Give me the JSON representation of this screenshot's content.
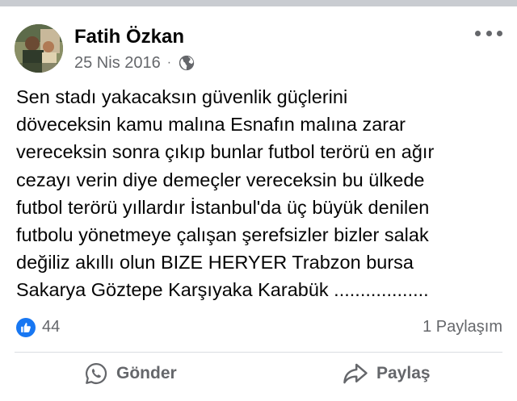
{
  "post": {
    "author": "Fatih Özkan",
    "date": "25 Nis 2016",
    "separator": "·",
    "privacy_icon": "globe-icon",
    "text_lines": [
      "Sen stadı yakacaksın güvenlik güçlerini",
      "döveceksin kamu malına Esnafın malına zarar",
      "vereceksin sonra çıkıp bunlar futbol terörü en ağır",
      "cezayı verin diye demeçler vereceksin bu ülkede",
      "futbol terörü yıllardır İstanbul'da üç büyük denilen",
      "futbolu yönetmeye çalışan şerefsizler bizler salak",
      "değiliz akıllı olun BIZE HERYER Trabzon bursa",
      "Sakarya Göztepe Karşıyaka Karabük .................."
    ]
  },
  "stats": {
    "like_count": "44",
    "share_count": "1 Paylaşım"
  },
  "actions": {
    "send_label": "Gönder",
    "share_label": "Paylaş"
  },
  "colors": {
    "like_blue": "#1877f2",
    "secondary_text": "#65676b",
    "primary_text": "#050505"
  }
}
